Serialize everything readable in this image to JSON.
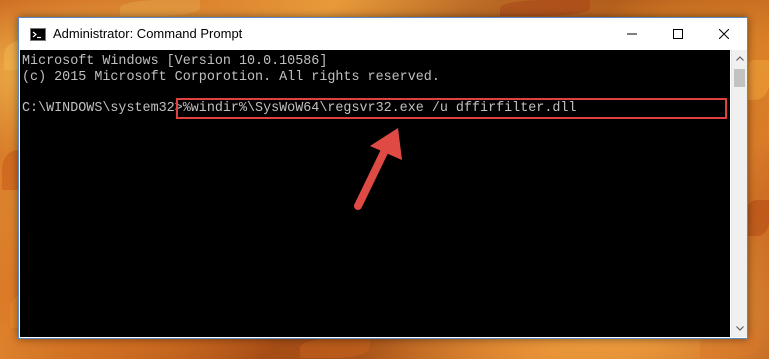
{
  "window": {
    "title": "Administrator: Command Prompt",
    "icon": "cmd-icon",
    "controls": {
      "minimize": "minimize-icon",
      "maximize": "maximize-icon",
      "close": "close-icon"
    }
  },
  "console": {
    "lines": [
      "Microsoft Windows [Version 10.0.10586]",
      "(c) 2015 Microsoft Corporotion. All rights reserved."
    ],
    "prompt": "C:\\WINDOWS\\system32>",
    "command": "%windir%\\SysWoW64\\regsvr32.exe /u dffirfilter.dll"
  },
  "annotation": {
    "highlight_color": "#e0413e",
    "arrow_color": "#e04a45"
  },
  "colors": {
    "console_bg": "#000000",
    "console_text": "#c0c0c0",
    "titlebar_bg": "#ffffff"
  }
}
